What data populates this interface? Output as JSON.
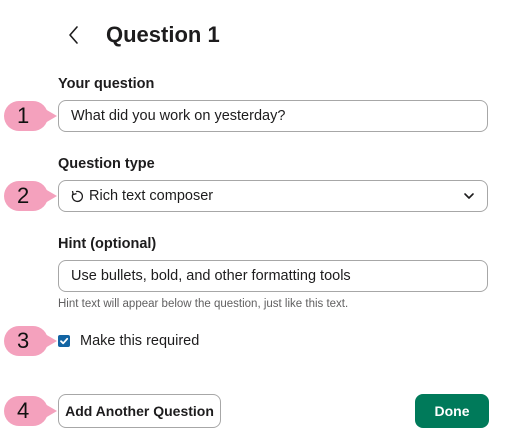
{
  "header": {
    "title": "Question 1",
    "back_icon": "chevron-left-icon"
  },
  "question": {
    "label": "Your question",
    "value": "What did you work on yesterday?"
  },
  "question_type": {
    "label": "Question type",
    "selected": "Rich text composer",
    "type_icon": "rich-text-icon",
    "dropdown_icon": "chevron-down-icon"
  },
  "hint": {
    "label": "Hint (optional)",
    "value": "Use bullets, bold, and other formatting tools",
    "helper": "Hint text will appear below the question, just like this text."
  },
  "required": {
    "label": "Make this required",
    "checked": true
  },
  "buttons": {
    "add_another": "Add Another Question",
    "done": "Done"
  },
  "callouts": [
    "1",
    "2",
    "3",
    "4"
  ],
  "colors": {
    "primary": "#007a5a",
    "checkbox": "#1264a3",
    "callout": "#f4a1bd"
  }
}
